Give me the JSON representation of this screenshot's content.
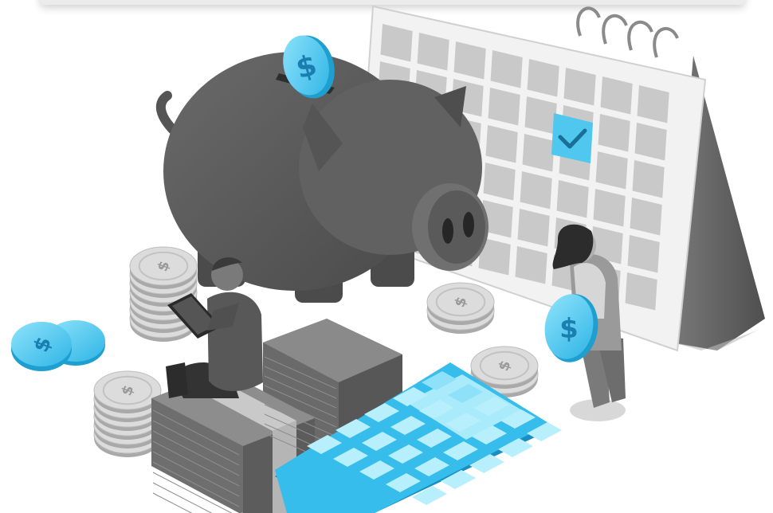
{
  "illustration": {
    "subject": "savings",
    "symbols": {
      "currency": "$"
    }
  },
  "colors": {
    "accent": "#3cc3ee",
    "accent_dark": "#1f9fd0",
    "accent_light": "#9ee6fb",
    "pig": "#5e5e5e",
    "paper": "#e6e6e6",
    "grey_coin": "#d4d4d4"
  }
}
